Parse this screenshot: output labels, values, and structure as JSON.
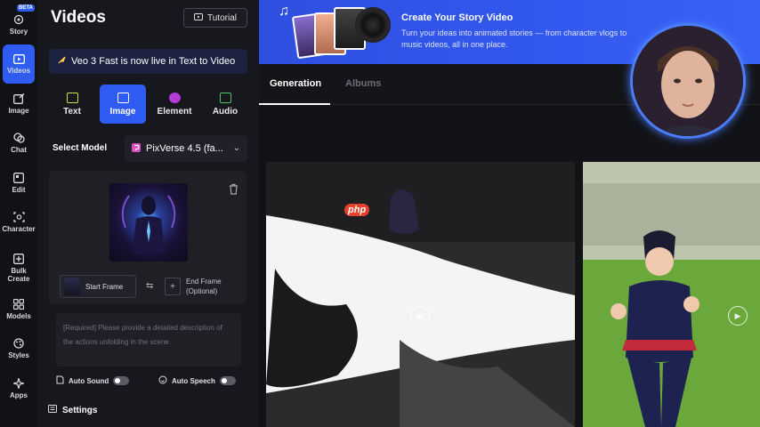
{
  "rail": {
    "beta_badge": "BETA",
    "items": [
      {
        "label": "Story",
        "icon": "story-icon"
      },
      {
        "label": "Videos",
        "icon": "videos-icon"
      },
      {
        "label": "Image",
        "icon": "image-edit-icon"
      },
      {
        "label": "Chat",
        "icon": "chat-icon"
      },
      {
        "label": "Edit",
        "icon": "edit-icon"
      },
      {
        "label": "Character",
        "icon": "character-icon"
      },
      {
        "label": "Bulk Create",
        "icon": "bulk-create-icon"
      },
      {
        "label": "Models",
        "icon": "models-icon"
      },
      {
        "label": "Styles",
        "icon": "styles-icon"
      },
      {
        "label": "Apps",
        "icon": "apps-icon"
      }
    ]
  },
  "panel": {
    "title": "Videos",
    "tutorial_label": "Tutorial",
    "banner_text": "Veo 3 Fast is now live in Text to Video",
    "tabs": [
      {
        "label": "Text",
        "color": "#c9e04a"
      },
      {
        "label": "Image",
        "color": "#ffffff"
      },
      {
        "label": "Element",
        "color": "#b43bd6"
      },
      {
        "label": "Audio",
        "color": "#4ec46a"
      }
    ],
    "select_model_label": "Select Model",
    "model_value": "PixVerse 4.5 (fa...",
    "start_frame_label": "Start Frame",
    "end_frame_label": "End Frame (Optional)",
    "description_placeholder": "[Required] Please provide a detailed description of the actions unfolding in the scene.",
    "auto_sound_label": "Auto Sound",
    "auto_speech_label": "Auto Speech",
    "settings_label": "Settings"
  },
  "story_banner": {
    "title": "Create Your Story Video",
    "subtitle": "Turn your ideas into animated stories — from character vlogs to music videos, all in one place."
  },
  "content_tabs": {
    "generation": "Generation",
    "albums": "Albums"
  },
  "watermark": "php",
  "colors": {
    "accent": "#2f5cf2",
    "panel_bg": "#17181d",
    "banner_bg": "#3358ef"
  }
}
